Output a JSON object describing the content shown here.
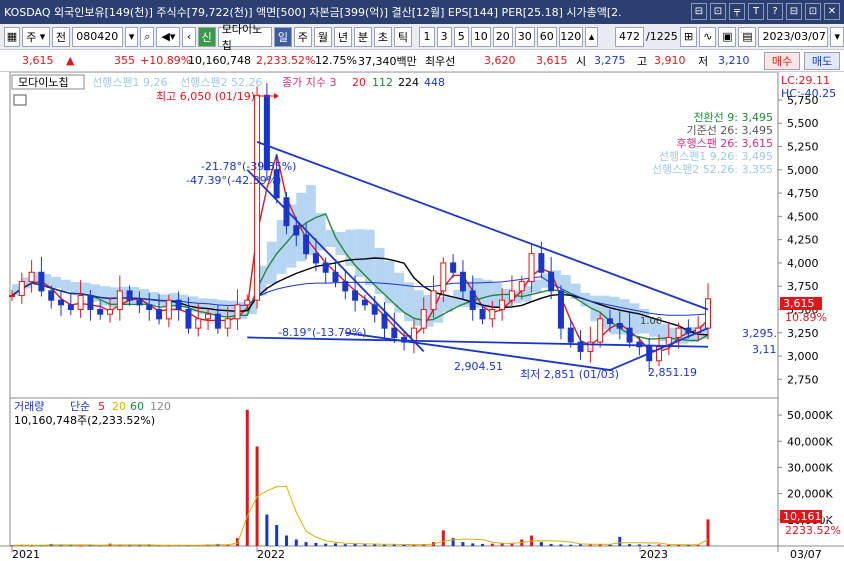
{
  "titlebar": {
    "text": "KOSDAQ 외국인보유[149(천)] 주식수[79,722(천)] 액면[500] 자본금[399(억)] 결산[12월] EPS[144] PER[25.18] 시가총액[2.",
    "icons": [
      "⊟",
      "⊡",
      "╤",
      "T",
      "?",
      "⊟",
      "⊡",
      "✕"
    ]
  },
  "toolbar": {
    "type_sel": "주",
    "mode": "전",
    "code": "080420",
    "market": "신",
    "name": "모다이노칩",
    "periods": [
      "일",
      "주",
      "월",
      "년",
      "분",
      "초",
      "틱"
    ],
    "active_period": "일",
    "counts": [
      "1",
      "3",
      "5",
      "10",
      "20",
      "30",
      "60",
      "120"
    ],
    "position": "472",
    "total": "/1225",
    "date": "2023/03/07"
  },
  "pricebar": {
    "price": "3,615",
    "arrow": "▲",
    "change": "355",
    "change_pct": "+10.89%",
    "volume": "10,160,748",
    "volume_pct": "2,233.52%",
    "turnover": "12.75%",
    "amount": "37,340백만",
    "priority_label": "최우선",
    "ask": "3,620",
    "bid": "3,615",
    "open_label": "시",
    "open": "3,275",
    "high_label": "고",
    "high": "3,910",
    "low_label": "저",
    "low": "3,210",
    "buy_btn": "매수",
    "sell_btn": "매도"
  },
  "legend": {
    "name": "모다이노칩",
    "span1": "선행스펜1 9,26",
    "span2": "선행스펜2 52,26",
    "ma_label": "종가 지수 3",
    "ma_periods": [
      "20",
      "112",
      "224",
      "448"
    ],
    "lc": "LC:29.11",
    "hc": "HC:-40.25"
  },
  "ichimoku_panel": [
    {
      "text": "전환선 9: 3,495",
      "color": "#1f8a3a"
    },
    {
      "text": "기준선 26: 3,495",
      "color": "#555555"
    },
    {
      "text": "후행스팬 26: 3,615",
      "color": "#c82f86"
    },
    {
      "text": "선행스펜1 9,26: 3,495",
      "color": "#9ec7ee"
    },
    {
      "text": "선행스펜2 52,26: 3,355",
      "color": "#9ec7ee"
    }
  ],
  "annotations": {
    "high": "최고 6,050 (01/19)",
    "low": "최저 2,851 (01/03)",
    "angle1": "-21.78°(-39.85%)",
    "angle2": "-47.39°(-42.39%)",
    "angle3": "-8.19°(-13.79%)",
    "label_2904": "2,904.51",
    "label_2851": "2,851.19",
    "label_3295": "3,295.",
    "label_311": "3,11",
    "wedge_overlap": "1.00",
    "sell_marker_price": "3,615",
    "sell_marker_pct": "10.89%"
  },
  "volume_panel": {
    "title": "거래량",
    "ma_label": "단순",
    "ma_periods": [
      "5",
      "20",
      "60",
      "120"
    ],
    "current": "10,160,748주(2,233.52%)",
    "cur_label": "10,161K",
    "cur_pct": "2233.52%"
  },
  "x_axis": {
    "labels": [
      "2021",
      "2022",
      "2023",
      "03/07"
    ]
  },
  "chart_data": [
    {
      "type": "candlestick",
      "title": "모다이노칩",
      "y_ticks": [
        2750,
        3000,
        3250,
        3500,
        3750,
        4000,
        4250,
        4500,
        4750,
        5000,
        5250,
        5500,
        5750
      ],
      "y_tick_labels": [
        "2,750",
        "3,000",
        "3,250",
        "3,500",
        "3,750",
        "4,000",
        "4,250",
        "4,500",
        "4,750",
        "5,000",
        "5,250",
        "5,500",
        "5,750"
      ],
      "ylim": [
        2550,
        6050
      ],
      "x_labels": [
        "2021",
        "2022",
        "2023"
      ],
      "close_series": [
        3650,
        3800,
        3900,
        3700,
        3600,
        3550,
        3500,
        3650,
        3500,
        3450,
        3500,
        3700,
        3600,
        3550,
        3500,
        3400,
        3600,
        3500,
        3300,
        3400,
        3450,
        3300,
        3400,
        3550,
        3600,
        5800,
        5000,
        4700,
        4400,
        4300,
        4100,
        4000,
        3900,
        3800,
        3700,
        3600,
        3550,
        3450,
        3300,
        3200,
        3150,
        3300,
        3500,
        3700,
        4000,
        3900,
        3700,
        3500,
        3400,
        3500,
        3600,
        3700,
        3800,
        4100,
        3900,
        3700,
        3300,
        3150,
        3050,
        3150,
        3400,
        3350,
        3300,
        3150,
        3100,
        2950,
        3100,
        3200,
        3300,
        3250,
        3300,
        3615
      ],
      "ichimoku": {
        "conversion_9": 3495,
        "base_26": 3495,
        "lagging_26": 3615,
        "leading_span1": 3495,
        "leading_span2": 3355
      },
      "price_high": 6050,
      "price_low": 2851
    },
    {
      "type": "bar",
      "title": "거래량",
      "y_ticks": [
        10000,
        20000,
        30000,
        40000,
        50000
      ],
      "y_tick_labels": [
        "10,000K",
        "20,000K",
        "30,000K",
        "40,000K",
        "50,000K"
      ],
      "ylim": [
        0,
        55000
      ],
      "values": [
        300,
        400,
        250,
        300,
        800,
        350,
        400,
        200,
        300,
        250,
        900,
        400,
        300,
        250,
        350,
        300,
        250,
        400,
        300,
        350,
        600,
        800,
        500,
        3000,
        52000,
        38000,
        12000,
        8000,
        4000,
        2500,
        1500,
        1200,
        900,
        1000,
        700,
        800,
        600,
        700,
        500,
        600,
        400,
        500,
        700,
        1500,
        6000,
        3000,
        1500,
        1000,
        800,
        900,
        1200,
        1000,
        2500,
        4000,
        1500,
        800,
        600,
        500,
        700,
        600,
        800,
        500,
        3500,
        700,
        600,
        500,
        600,
        500,
        400,
        500,
        450,
        10161
      ],
      "current": 10161
    }
  ]
}
